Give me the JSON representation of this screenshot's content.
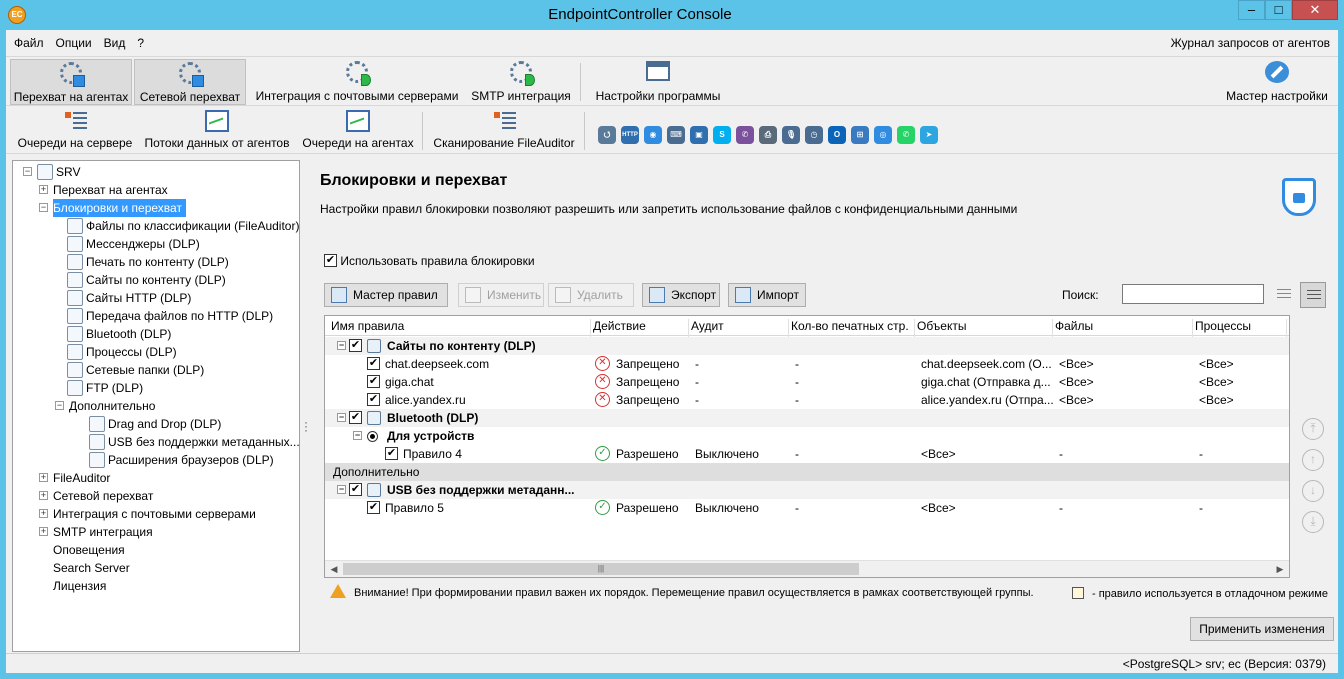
{
  "window": {
    "title": "EndpointController Console",
    "logo": "EC",
    "minimize": "–",
    "maximize": "□",
    "close": "✕"
  },
  "menu": {
    "items": [
      "Файл",
      "Опции",
      "Вид",
      "?"
    ],
    "right": "Журнал запросов от агентов"
  },
  "ribbon1": [
    {
      "label": "Перехват на агентах",
      "icon": "gear-icon",
      "active": true
    },
    {
      "label": "Сетевой перехват",
      "icon": "gear-icon",
      "active": true
    },
    {
      "label": "Интеграция с почтовыми серверами",
      "icon": "gear-play-icon"
    },
    {
      "label": "SMTP интеграция",
      "icon": "gear-play-icon"
    },
    {
      "label": "Настройки программы",
      "icon": "window-settings-icon"
    },
    {
      "label": "Мастер настройки",
      "icon": "wrench-icon"
    }
  ],
  "ribbon2": [
    {
      "label": "Очереди на сервере",
      "icon": "queue-icon"
    },
    {
      "label": "Потоки данных от агентов",
      "icon": "chart-search-icon"
    },
    {
      "label": "Очереди на агентах",
      "icon": "chart-search-icon"
    },
    {
      "label": "Сканирование FileAuditor",
      "icon": "scan-icon"
    }
  ],
  "quick_icons": [
    {
      "name": "usb-icon",
      "glyph": "⭯",
      "color": "#5a7a9a"
    },
    {
      "name": "http-icon",
      "glyph": "HTTP",
      "color": "#2f6fb0"
    },
    {
      "name": "globe-icon",
      "glyph": "◉",
      "color": "#2f8ce0"
    },
    {
      "name": "keyboard-icon",
      "glyph": "⌨",
      "color": "#4a6c90"
    },
    {
      "name": "monitor-icon",
      "glyph": "▣",
      "color": "#2f6fb0"
    },
    {
      "name": "skype-icon",
      "glyph": "S",
      "color": "#00aff0"
    },
    {
      "name": "viber-icon",
      "glyph": "✆",
      "color": "#7b519d"
    },
    {
      "name": "printer-icon",
      "glyph": "⎙",
      "color": "#5a6a7a"
    },
    {
      "name": "microphone-icon",
      "glyph": "🎙",
      "color": "#4a6c90"
    },
    {
      "name": "clock-icon",
      "glyph": "◷",
      "color": "#4a6c90"
    },
    {
      "name": "outlook-icon",
      "glyph": "O",
      "color": "#0a64b8"
    },
    {
      "name": "network-icon",
      "glyph": "⊞",
      "color": "#3a7ac0"
    },
    {
      "name": "webcam-icon",
      "glyph": "◎",
      "color": "#2f8ce0"
    },
    {
      "name": "whatsapp-icon",
      "glyph": "✆",
      "color": "#25d366"
    },
    {
      "name": "telegram-icon",
      "glyph": "➤",
      "color": "#2ca5e0"
    }
  ],
  "tree": [
    {
      "label": "SRV",
      "level": 0,
      "exp": "−",
      "icon": "server-icon"
    },
    {
      "label": "Перехват на агентах",
      "level": 1,
      "exp": "+"
    },
    {
      "label": "Блокировки и перехват",
      "level": 1,
      "exp": "−",
      "selected": true
    },
    {
      "label": "Файлы по классификации (FileAuditor)",
      "level": 2,
      "icon": "file-check-icon"
    },
    {
      "label": "Мессенджеры (DLP)",
      "level": 2,
      "icon": "messenger-icon"
    },
    {
      "label": "Печать по контенту (DLP)",
      "level": 2,
      "icon": "printer-icon"
    },
    {
      "label": "Сайты по контенту (DLP)",
      "level": 2,
      "icon": "website-icon"
    },
    {
      "label": "Сайты HTTP (DLP)",
      "level": 2,
      "icon": "http-icon"
    },
    {
      "label": "Передача файлов по HTTP (DLP)",
      "level": 2,
      "icon": "globe-icon"
    },
    {
      "label": "Bluetooth (DLP)",
      "level": 2,
      "icon": "bluetooth-icon"
    },
    {
      "label": "Процессы (DLP)",
      "level": 2,
      "icon": "process-chart-icon"
    },
    {
      "label": "Сетевые папки (DLP)",
      "level": 2,
      "icon": "folder-icon"
    },
    {
      "label": "FTP (DLP)",
      "level": 2,
      "icon": "ftp-icon"
    },
    {
      "label": "Дополнительно",
      "level": 2,
      "exp": "−"
    },
    {
      "label": "Drag and Drop (DLP)",
      "level": 3,
      "icon": "drag-drop-icon"
    },
    {
      "label": "USB без поддержки метаданных...",
      "level": 3,
      "icon": "usb-icon"
    },
    {
      "label": "Расширения браузеров (DLP)",
      "level": 3,
      "icon": "http-icon"
    },
    {
      "label": "FileAuditor",
      "level": 1,
      "exp": "+"
    },
    {
      "label": "Сетевой перехват",
      "level": 1,
      "exp": "+"
    },
    {
      "label": "Интеграция с почтовыми серверами",
      "level": 1,
      "exp": "+"
    },
    {
      "label": "SMTP интеграция",
      "level": 1,
      "exp": "+"
    },
    {
      "label": "Оповещения",
      "level": 1
    },
    {
      "label": "Search Server",
      "level": 1
    },
    {
      "label": "Лицензия",
      "level": 1
    }
  ],
  "main": {
    "title": "Блокировки и перехват",
    "description": "Настройки правил блокировки позволяют разрешить или запретить использование файлов с конфиденциальными данными",
    "use_rules_label": "Использовать правила блокировки",
    "use_rules_checked": "✔",
    "buttons": {
      "wizard": "Мастер правил",
      "edit": "Изменить",
      "delete": "Удалить",
      "export": "Экспорт",
      "import": "Импорт"
    },
    "search_label": "Поиск:",
    "search_value": ""
  },
  "grid": {
    "columns": [
      "Имя правила",
      "Действие",
      "Аудит",
      "Кол-во печатных стр.",
      "Объекты",
      "Файлы",
      "Процессы"
    ],
    "rows": [
      {
        "type": "group",
        "name": "Сайты по контенту (DLP)",
        "icon": "website-icon"
      },
      {
        "type": "rule",
        "name": "chat.deepseek.com",
        "action": "Запрещено",
        "status": "deny",
        "audit": "-",
        "pages": "-",
        "objects": "chat.deepseek.com (О...",
        "files": "<Все>",
        "processes": "<Все>"
      },
      {
        "type": "rule",
        "name": "giga.chat",
        "action": "Запрещено",
        "status": "deny",
        "audit": "-",
        "pages": "-",
        "objects": "giga.chat (Отправка д...",
        "files": "<Все>",
        "processes": "<Все>"
      },
      {
        "type": "rule",
        "name": "alice.yandex.ru",
        "action": "Запрещено",
        "status": "deny",
        "audit": "-",
        "pages": "-",
        "objects": "alice.yandex.ru (Отпра...",
        "files": "<Все>",
        "processes": "<Все>"
      },
      {
        "type": "group",
        "name": "Bluetooth (DLP)",
        "icon": "bluetooth-icon"
      },
      {
        "type": "subgroup",
        "name": "Для устройств"
      },
      {
        "type": "subrule",
        "name": "Правило 4",
        "action": "Разрешено",
        "status": "allow",
        "audit": "Выключено",
        "pages": "-",
        "objects": "<Все>",
        "files": "-",
        "processes": "-"
      },
      {
        "type": "section",
        "name": "Дополнительно"
      },
      {
        "type": "group",
        "name": "USB без поддержки метаданн...",
        "icon": "usb-icon"
      },
      {
        "type": "rule",
        "name": "Правило 5",
        "action": "Разрешено",
        "status": "allow",
        "audit": "Выключено",
        "pages": "-",
        "objects": "<Все>",
        "files": "-",
        "processes": "-"
      }
    ],
    "scroll_left": "◀",
    "scroll_right": "▶",
    "scroll_grip": "|||"
  },
  "side_arrows": [
    "⤒",
    "↑",
    "↓",
    "⤓"
  ],
  "warning": "Внимание! При формировании правил важен их порядок. Перемещение правил осуществляется в рамках соответствующей группы.",
  "debug_legend": "- правило используется в отладочном режиме",
  "apply_button": "Применить изменения",
  "status": "<PostgreSQL> srv; ec (Версия: 0379)",
  "colors": {
    "titlebar": "#5bc3e8",
    "selection": "#3399ff",
    "deny": "#d83030",
    "allow": "#2f9e44"
  }
}
